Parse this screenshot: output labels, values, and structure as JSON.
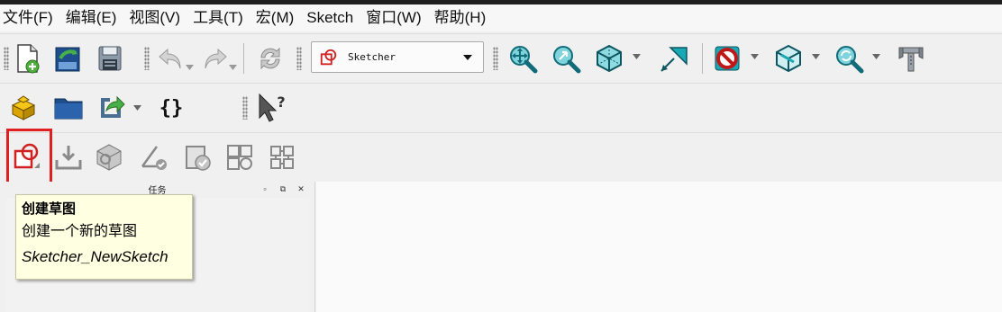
{
  "menubar": {
    "items": [
      "文件(F)",
      "编辑(E)",
      "视图(V)",
      "工具(T)",
      "宏(M)",
      "Sketch",
      "窗口(W)",
      "帮助(H)"
    ]
  },
  "toolbar1": {
    "workbench_combo": {
      "selected": "Sketcher",
      "icon": "sketcher-workbench-icon"
    },
    "icons": [
      "new-document-icon",
      "open-document-icon",
      "save-icon",
      "undo-icon",
      "redo-icon",
      "refresh-icon",
      "zoom-fit-all-icon",
      "zoom-selection-icon",
      "isometric-view-icon",
      "measure-icon",
      "no-draw-style-icon",
      "bounding-box-icon",
      "view-sync-icon",
      "caliper-icon"
    ]
  },
  "toolbar2": {
    "icons": [
      "part-icon",
      "folder-icon",
      "link-icon",
      "json-braces-icon",
      "whats-this-icon"
    ]
  },
  "toolbar3": {
    "icons": [
      "new-sketch-icon",
      "map-sketch-icon",
      "reorient-sketch-icon",
      "validate-sketch-icon",
      "merge-sketches-icon",
      "mirror-sketch-icon",
      "sketch-array-icon"
    ]
  },
  "taskpane": {
    "title": "任务"
  },
  "tooltip": {
    "title": "创建草图",
    "description": "创建一个新的草图",
    "command": "Sketcher_NewSketch"
  },
  "colors": {
    "highlight": "#e02020",
    "tooltip_bg": "#ffffe1",
    "accent_teal": "#18a9b5"
  }
}
